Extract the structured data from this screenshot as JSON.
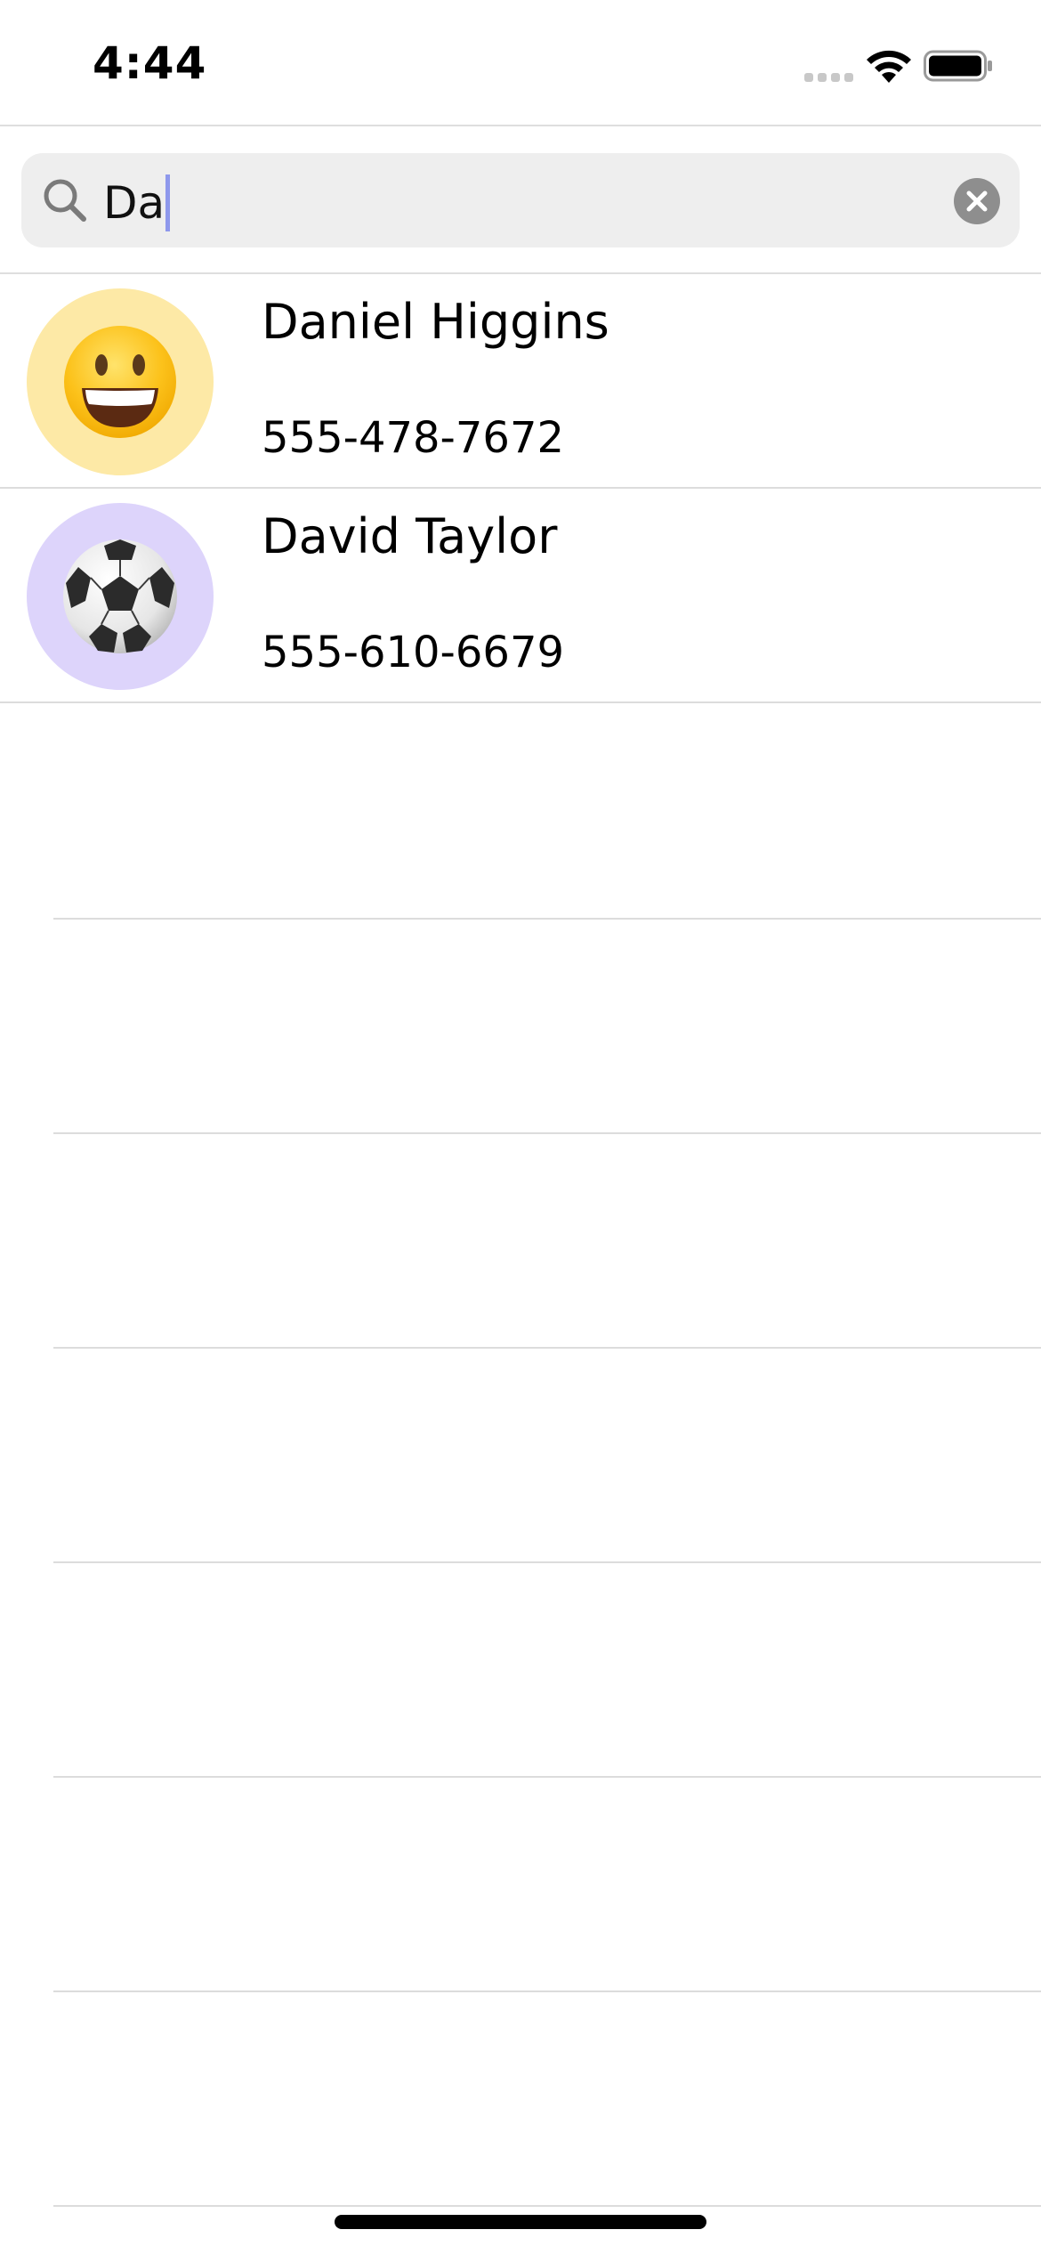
{
  "status_bar": {
    "time": "4:44"
  },
  "search": {
    "value": "Da",
    "icon": "magnifying-glass",
    "clear_icon": "xmark-circle"
  },
  "contacts": [
    {
      "name": "Daniel Higgins",
      "phone": "555-478-7672",
      "avatar_emoji": "😀",
      "avatar_color": "#fde9a6"
    },
    {
      "name": "David Taylor",
      "phone": "555-610-6679",
      "avatar_emoji": "⚽",
      "avatar_color": "#ddd4fb"
    }
  ],
  "colors": {
    "search_background": "#eeeeee",
    "caret": "#8e98ec",
    "divider": "#dcdcdc"
  }
}
